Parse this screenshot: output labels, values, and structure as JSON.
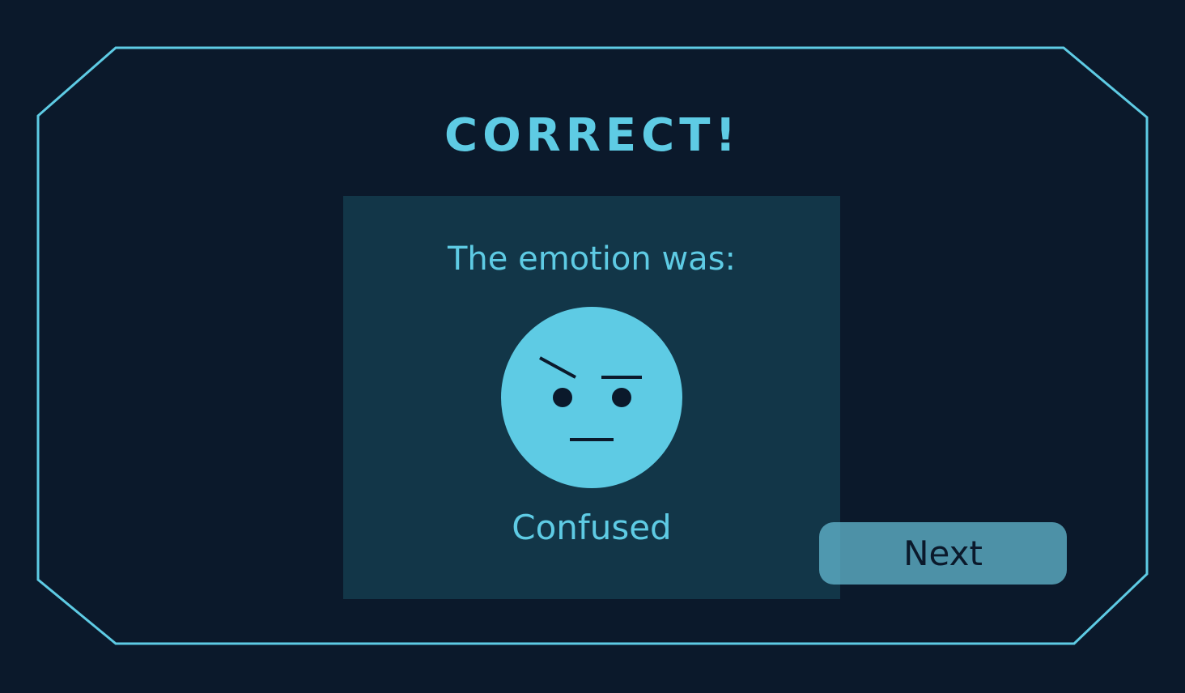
{
  "result": {
    "title": "CORRECT!"
  },
  "card": {
    "prompt": "The emotion was:",
    "emotion_name": "Confused",
    "emoji_icon": "confused-face-icon"
  },
  "controls": {
    "next_label": "Next"
  },
  "colors": {
    "background": "#0b192b",
    "accent": "#5ecbe4",
    "card": "#123648",
    "button": "#64bad2",
    "face_features": "#0b192b"
  }
}
